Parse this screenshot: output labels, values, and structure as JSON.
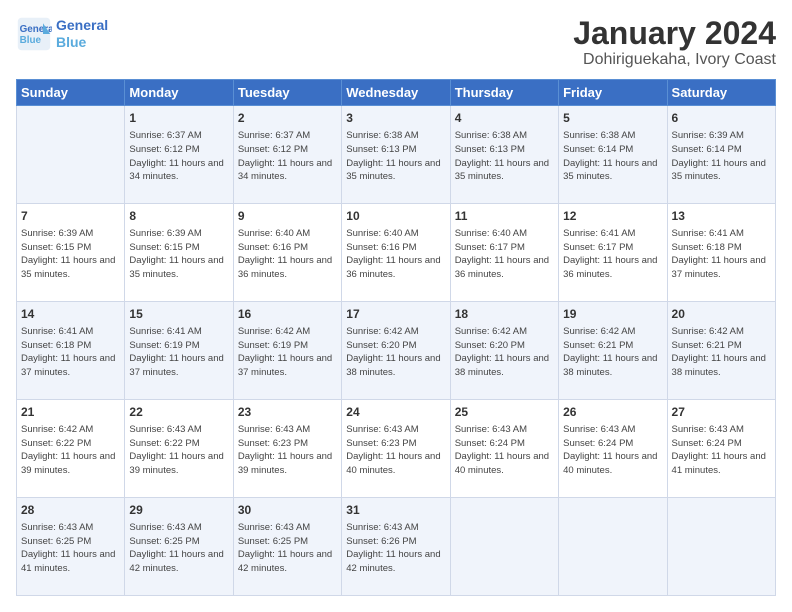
{
  "header": {
    "logo_line1": "General",
    "logo_line2": "Blue",
    "title": "January 2024",
    "subtitle": "Dohiriguekaha, Ivory Coast"
  },
  "days_of_week": [
    "Sunday",
    "Monday",
    "Tuesday",
    "Wednesday",
    "Thursday",
    "Friday",
    "Saturday"
  ],
  "weeks": [
    [
      {
        "day": "",
        "sunrise": "",
        "sunset": "",
        "daylight": ""
      },
      {
        "day": "1",
        "sunrise": "Sunrise: 6:37 AM",
        "sunset": "Sunset: 6:12 PM",
        "daylight": "Daylight: 11 hours and 34 minutes."
      },
      {
        "day": "2",
        "sunrise": "Sunrise: 6:37 AM",
        "sunset": "Sunset: 6:12 PM",
        "daylight": "Daylight: 11 hours and 34 minutes."
      },
      {
        "day": "3",
        "sunrise": "Sunrise: 6:38 AM",
        "sunset": "Sunset: 6:13 PM",
        "daylight": "Daylight: 11 hours and 35 minutes."
      },
      {
        "day": "4",
        "sunrise": "Sunrise: 6:38 AM",
        "sunset": "Sunset: 6:13 PM",
        "daylight": "Daylight: 11 hours and 35 minutes."
      },
      {
        "day": "5",
        "sunrise": "Sunrise: 6:38 AM",
        "sunset": "Sunset: 6:14 PM",
        "daylight": "Daylight: 11 hours and 35 minutes."
      },
      {
        "day": "6",
        "sunrise": "Sunrise: 6:39 AM",
        "sunset": "Sunset: 6:14 PM",
        "daylight": "Daylight: 11 hours and 35 minutes."
      }
    ],
    [
      {
        "day": "7",
        "sunrise": "Sunrise: 6:39 AM",
        "sunset": "Sunset: 6:15 PM",
        "daylight": "Daylight: 11 hours and 35 minutes."
      },
      {
        "day": "8",
        "sunrise": "Sunrise: 6:39 AM",
        "sunset": "Sunset: 6:15 PM",
        "daylight": "Daylight: 11 hours and 35 minutes."
      },
      {
        "day": "9",
        "sunrise": "Sunrise: 6:40 AM",
        "sunset": "Sunset: 6:16 PM",
        "daylight": "Daylight: 11 hours and 36 minutes."
      },
      {
        "day": "10",
        "sunrise": "Sunrise: 6:40 AM",
        "sunset": "Sunset: 6:16 PM",
        "daylight": "Daylight: 11 hours and 36 minutes."
      },
      {
        "day": "11",
        "sunrise": "Sunrise: 6:40 AM",
        "sunset": "Sunset: 6:17 PM",
        "daylight": "Daylight: 11 hours and 36 minutes."
      },
      {
        "day": "12",
        "sunrise": "Sunrise: 6:41 AM",
        "sunset": "Sunset: 6:17 PM",
        "daylight": "Daylight: 11 hours and 36 minutes."
      },
      {
        "day": "13",
        "sunrise": "Sunrise: 6:41 AM",
        "sunset": "Sunset: 6:18 PM",
        "daylight": "Daylight: 11 hours and 37 minutes."
      }
    ],
    [
      {
        "day": "14",
        "sunrise": "Sunrise: 6:41 AM",
        "sunset": "Sunset: 6:18 PM",
        "daylight": "Daylight: 11 hours and 37 minutes."
      },
      {
        "day": "15",
        "sunrise": "Sunrise: 6:41 AM",
        "sunset": "Sunset: 6:19 PM",
        "daylight": "Daylight: 11 hours and 37 minutes."
      },
      {
        "day": "16",
        "sunrise": "Sunrise: 6:42 AM",
        "sunset": "Sunset: 6:19 PM",
        "daylight": "Daylight: 11 hours and 37 minutes."
      },
      {
        "day": "17",
        "sunrise": "Sunrise: 6:42 AM",
        "sunset": "Sunset: 6:20 PM",
        "daylight": "Daylight: 11 hours and 38 minutes."
      },
      {
        "day": "18",
        "sunrise": "Sunrise: 6:42 AM",
        "sunset": "Sunset: 6:20 PM",
        "daylight": "Daylight: 11 hours and 38 minutes."
      },
      {
        "day": "19",
        "sunrise": "Sunrise: 6:42 AM",
        "sunset": "Sunset: 6:21 PM",
        "daylight": "Daylight: 11 hours and 38 minutes."
      },
      {
        "day": "20",
        "sunrise": "Sunrise: 6:42 AM",
        "sunset": "Sunset: 6:21 PM",
        "daylight": "Daylight: 11 hours and 38 minutes."
      }
    ],
    [
      {
        "day": "21",
        "sunrise": "Sunrise: 6:42 AM",
        "sunset": "Sunset: 6:22 PM",
        "daylight": "Daylight: 11 hours and 39 minutes."
      },
      {
        "day": "22",
        "sunrise": "Sunrise: 6:43 AM",
        "sunset": "Sunset: 6:22 PM",
        "daylight": "Daylight: 11 hours and 39 minutes."
      },
      {
        "day": "23",
        "sunrise": "Sunrise: 6:43 AM",
        "sunset": "Sunset: 6:23 PM",
        "daylight": "Daylight: 11 hours and 39 minutes."
      },
      {
        "day": "24",
        "sunrise": "Sunrise: 6:43 AM",
        "sunset": "Sunset: 6:23 PM",
        "daylight": "Daylight: 11 hours and 40 minutes."
      },
      {
        "day": "25",
        "sunrise": "Sunrise: 6:43 AM",
        "sunset": "Sunset: 6:24 PM",
        "daylight": "Daylight: 11 hours and 40 minutes."
      },
      {
        "day": "26",
        "sunrise": "Sunrise: 6:43 AM",
        "sunset": "Sunset: 6:24 PM",
        "daylight": "Daylight: 11 hours and 40 minutes."
      },
      {
        "day": "27",
        "sunrise": "Sunrise: 6:43 AM",
        "sunset": "Sunset: 6:24 PM",
        "daylight": "Daylight: 11 hours and 41 minutes."
      }
    ],
    [
      {
        "day": "28",
        "sunrise": "Sunrise: 6:43 AM",
        "sunset": "Sunset: 6:25 PM",
        "daylight": "Daylight: 11 hours and 41 minutes."
      },
      {
        "day": "29",
        "sunrise": "Sunrise: 6:43 AM",
        "sunset": "Sunset: 6:25 PM",
        "daylight": "Daylight: 11 hours and 42 minutes."
      },
      {
        "day": "30",
        "sunrise": "Sunrise: 6:43 AM",
        "sunset": "Sunset: 6:25 PM",
        "daylight": "Daylight: 11 hours and 42 minutes."
      },
      {
        "day": "31",
        "sunrise": "Sunrise: 6:43 AM",
        "sunset": "Sunset: 6:26 PM",
        "daylight": "Daylight: 11 hours and 42 minutes."
      },
      {
        "day": "",
        "sunrise": "",
        "sunset": "",
        "daylight": ""
      },
      {
        "day": "",
        "sunrise": "",
        "sunset": "",
        "daylight": ""
      },
      {
        "day": "",
        "sunrise": "",
        "sunset": "",
        "daylight": ""
      }
    ]
  ]
}
